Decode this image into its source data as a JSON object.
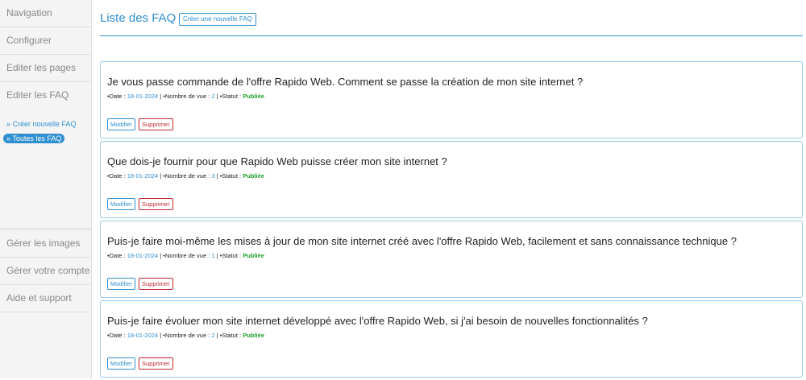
{
  "sidebar": {
    "top_items": [
      {
        "label": "Navigation"
      },
      {
        "label": "Configurer"
      },
      {
        "label": "Editer les pages"
      },
      {
        "label": "Editer les FAQ"
      }
    ],
    "sub_items": [
      {
        "label": "» Créer nouvelle FAQ"
      },
      {
        "label": "» Toutes les FAQ"
      }
    ],
    "bottom_items": [
      {
        "label": "Gérer les images"
      },
      {
        "label": "Gérer votre compte"
      },
      {
        "label": "Aide et support"
      }
    ]
  },
  "header": {
    "title": "Liste des FAQ",
    "create_label": "Créer une nouvelle FAQ"
  },
  "meta_labels": {
    "date": "•Date :",
    "views": "| •Nombre de vue :",
    "status": "| •Statut :",
    "sep": "|"
  },
  "actions": {
    "edit": "Modifier",
    "delete": "Supprimer"
  },
  "faqs": [
    {
      "question": "Je vous passe commande de l'offre Rapido Web. Comment se passe la création de mon site internet ?",
      "date": "18-01-2024",
      "views": "2",
      "status": "Publiée"
    },
    {
      "question": "Que dois-je fournir pour que Rapido Web puisse créer mon site internet ?",
      "date": "18-01-2024",
      "views": "3",
      "status": "Publiée"
    },
    {
      "question": "Puis-je faire moi-même les mises à jour de mon site internet créé avec l'offre Rapido Web, facilement et sans connaissance technique ?",
      "date": "18-01-2024",
      "views": "1",
      "status": "Publiée"
    },
    {
      "question": "Puis-je faire évoluer mon site internet développé avec l'offre Rapido Web, si j'ai besoin de nouvelles fonctionnalités ?",
      "date": "18-01-2024",
      "views": "2",
      "status": "Publiée"
    }
  ]
}
